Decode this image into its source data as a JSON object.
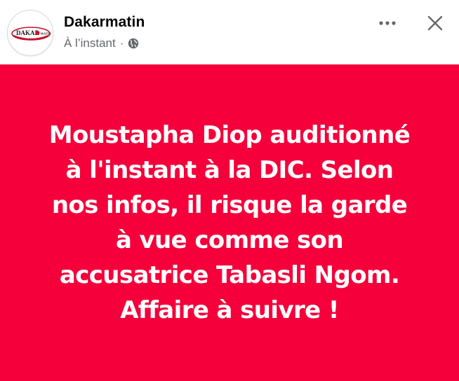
{
  "post": {
    "author": "Dakarmatin",
    "timestamp": "À l’instant",
    "separator": "·",
    "privacy_icon": "globe-icon",
    "lines": [
      "Moustapha Diop auditionné",
      "à l'instant à la DIC. Selon",
      "nos infos, il risque la garde",
      "à vue comme son",
      "accusatrice Tabasli Ngom.",
      "Affaire à suivre !"
    ],
    "background_color": "#f5003a",
    "text_color": "#ffffff"
  },
  "avatar": {
    "logo_text_left": "DAKAR",
    "logo_text_right": "MATIN"
  },
  "actions": {
    "more_icon": "more-horizontal-icon",
    "close_icon": "close-icon"
  }
}
